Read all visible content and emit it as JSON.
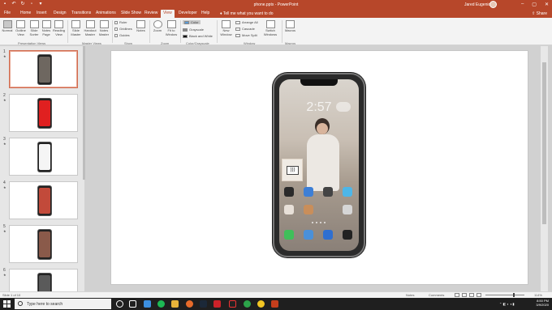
{
  "window": {
    "title": "phone.pptx - PowerPoint",
    "user": "Jared Eugenio",
    "controls": [
      "–",
      "▢",
      "✕"
    ]
  },
  "tabs": [
    {
      "label": "File"
    },
    {
      "label": "Home"
    },
    {
      "label": "Insert"
    },
    {
      "label": "Design"
    },
    {
      "label": "Transitions"
    },
    {
      "label": "Animations"
    },
    {
      "label": "Slide Show"
    },
    {
      "label": "Review"
    },
    {
      "label": "View"
    },
    {
      "label": "Developer"
    },
    {
      "label": "Help"
    }
  ],
  "tell_me": "Tell me what you want to do",
  "share": "Share",
  "ribbon": {
    "presentation_views": [
      "Normal",
      "Outline View",
      "Slide Sorter",
      "Notes Page",
      "Reading View"
    ],
    "master_views": [
      "Slide Master",
      "Handout Master",
      "Notes Master"
    ],
    "show": [
      "Ruler",
      "Gridlines",
      "Guides"
    ],
    "notes": "Notes",
    "zoom": [
      "Zoom",
      "Fit to Window"
    ],
    "color": [
      "Color",
      "Grayscale",
      "Black and White"
    ],
    "window": {
      "new": "New Window",
      "arrange": "Arrange All",
      "cascade": "Cascade",
      "split": "Move Split"
    },
    "switch": "Switch Windows",
    "macros": "Macros",
    "groups": [
      "Presentation Views",
      "Master Views",
      "Show",
      "Zoom",
      "Color/Grayscale",
      "Window",
      "Macros"
    ]
  },
  "slides": [
    {
      "number": "1",
      "screen": "#6e6760"
    },
    {
      "number": "2",
      "screen": "#e02020"
    },
    {
      "number": "3",
      "screen": "#f5f5f5"
    },
    {
      "number": "4",
      "screen": "#c24a3a"
    },
    {
      "number": "5",
      "screen": "#8a5a4a"
    },
    {
      "number": "6",
      "screen": "#5a5a5a"
    }
  ],
  "phone": {
    "clock": "2:57",
    "widget_text": ")))"
  },
  "status": {
    "slide_info": "Slide 1 of 10",
    "notes": "Notes",
    "comments": "Comments",
    "zoom": "114%"
  },
  "taskbar": {
    "search_placeholder": "Type here to search",
    "time": "8:50 PM",
    "date": "3/9/2020"
  },
  "colors": {
    "accent": "#b7472a",
    "taskbar": "#1f1f1f"
  }
}
